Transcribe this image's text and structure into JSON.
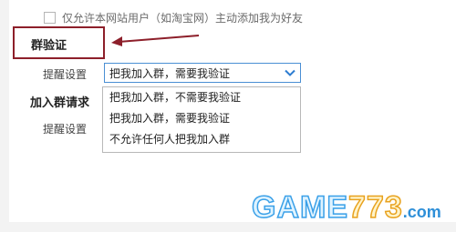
{
  "top_option": {
    "label": "仅允许本网站用户（如淘宝网）主动添加我为好友",
    "checked": false
  },
  "group_verify": {
    "title": "群验证",
    "setting_label": "提醒设置",
    "selected_value": "把我加入群，需要我验证",
    "options": [
      "把我加入群，不需要我验证",
      "把我加入群，需要我验证",
      "不允许任何人把我加入群"
    ]
  },
  "join_request": {
    "title": "加入群请求",
    "setting_label": "提醒设置"
  },
  "watermark": {
    "game": "GAME",
    "number": "773",
    "suffix": ".com"
  },
  "colors": {
    "highlight": "#8d1f2a",
    "select_border": "#4a8fd4",
    "chevron": "#2e7dd1"
  }
}
